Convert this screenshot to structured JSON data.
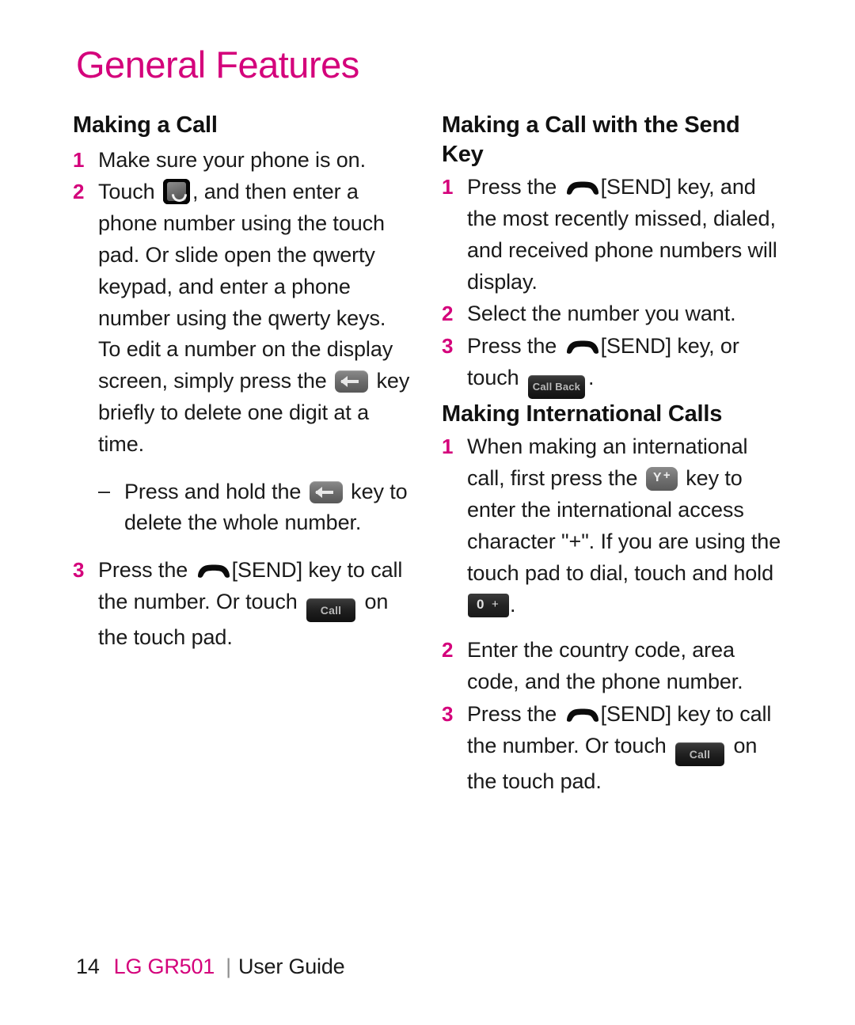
{
  "page": {
    "title": "General Features",
    "accent_color": "#D4017B",
    "background_color": "#FFFFFF",
    "text_color": "#1A1A1A"
  },
  "left_column": {
    "heading": "Making a Call",
    "steps": [
      {
        "num": "1",
        "parts": [
          {
            "t": "text",
            "v": "Make sure your phone is on."
          }
        ]
      },
      {
        "num": "2",
        "parts": [
          {
            "t": "text",
            "v": "Touch "
          },
          {
            "t": "icon",
            "v": "dialer-app-icon"
          },
          {
            "t": "text",
            "v": ", and then enter a phone number using the touch pad. Or slide open the qwerty keypad, and enter a phone number using the qwerty keys. To edit a number on the display screen, simply press the "
          },
          {
            "t": "icon",
            "v": "backspace-key-icon"
          },
          {
            "t": "text",
            "v": " key briefly to delete one digit at a time."
          }
        ],
        "sub": {
          "dash": "–",
          "parts": [
            {
              "t": "text",
              "v": "Press and hold the "
            },
            {
              "t": "icon",
              "v": "backspace-key-icon"
            },
            {
              "t": "text",
              "v": " key to delete the whole number."
            }
          ]
        }
      },
      {
        "num": "3",
        "parts": [
          {
            "t": "text",
            "v": "Press the "
          },
          {
            "t": "icon",
            "v": "send-key-icon"
          },
          {
            "t": "text",
            "v": "[SEND] key to call the number. Or touch "
          },
          {
            "t": "icon",
            "v": "call-softkey"
          },
          {
            "t": "text",
            "v": " on the touch pad."
          }
        ]
      }
    ]
  },
  "right_column": {
    "heading_send": "Making a Call with the Send Key",
    "send_steps": [
      {
        "num": "1",
        "parts": [
          {
            "t": "text",
            "v": "Press the "
          },
          {
            "t": "icon",
            "v": "send-key-icon"
          },
          {
            "t": "text",
            "v": "[SEND] key, and the most recently missed, dialed, and received phone numbers will display."
          }
        ]
      },
      {
        "num": "2",
        "parts": [
          {
            "t": "text",
            "v": "Select the number you want."
          }
        ]
      },
      {
        "num": "3",
        "parts": [
          {
            "t": "text",
            "v": "Press the "
          },
          {
            "t": "icon",
            "v": "send-key-icon"
          },
          {
            "t": "text",
            "v": "[SEND] key, or touch "
          },
          {
            "t": "icon",
            "v": "call-back-softkey"
          },
          {
            "t": "text",
            "v": "."
          }
        ]
      }
    ],
    "heading_intl": "Making International Calls",
    "intl_steps": [
      {
        "num": "1",
        "parts": [
          {
            "t": "text",
            "v": "When making an international call, first press the "
          },
          {
            "t": "icon",
            "v": "y-plus-key-icon"
          },
          {
            "t": "text",
            "v": " key to enter the international access character \"+\". If you are using the touch pad to dial, touch and hold "
          },
          {
            "t": "icon",
            "v": "zero-plus-key-icon"
          },
          {
            "t": "text",
            "v": "."
          }
        ]
      },
      {
        "num": "2",
        "parts": [
          {
            "t": "text",
            "v": "Enter the country code, area code, and the phone number."
          }
        ]
      },
      {
        "num": "3",
        "parts": [
          {
            "t": "text",
            "v": "Press the "
          },
          {
            "t": "icon",
            "v": "send-key-icon"
          },
          {
            "t": "text",
            "v": "[SEND] key to call the number. Or touch "
          },
          {
            "t": "icon",
            "v": "call-softkey"
          },
          {
            "t": "text",
            "v": " on the touch pad."
          }
        ]
      }
    ]
  },
  "icon_labels": {
    "call_softkey": "Call",
    "call_back_softkey": "Call Back",
    "y_key_letter": "Y",
    "y_key_plus": "+",
    "zero_key_digit": "0",
    "zero_key_plus": "+"
  },
  "footer": {
    "page_number": "14",
    "model": "LG GR501",
    "separator": "|",
    "guide": "User Guide"
  }
}
